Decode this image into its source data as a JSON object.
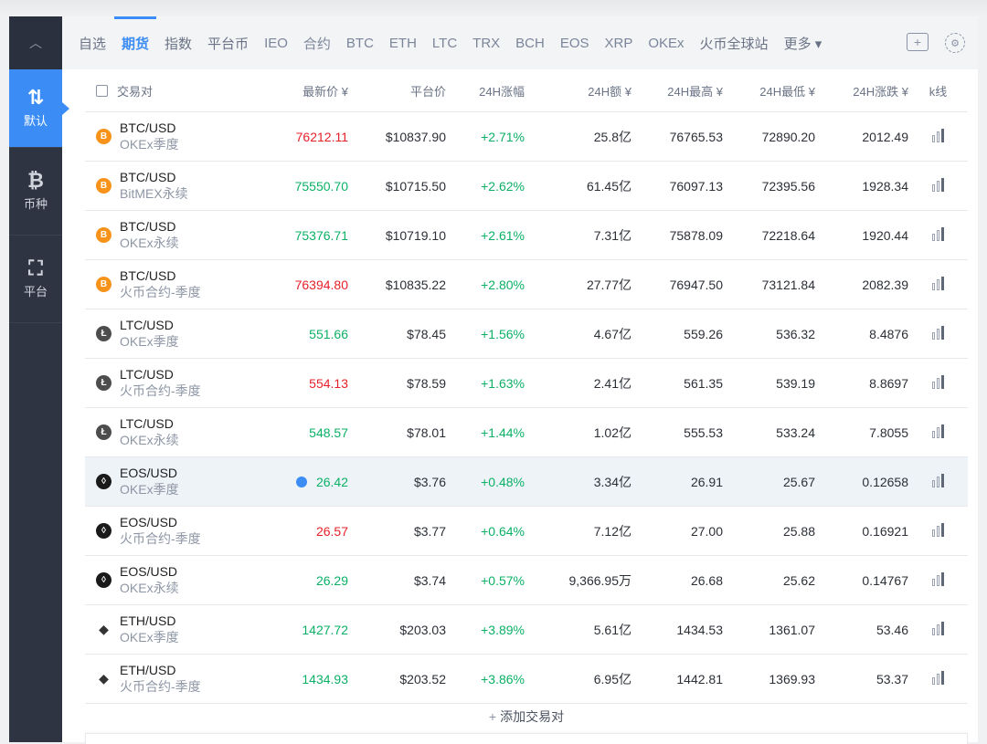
{
  "sidebar": {
    "collapse_icon": "chevron-up-icon",
    "items": [
      {
        "label": "默认",
        "icon": "sort-arrows-icon",
        "glyph": "⇅",
        "active": true
      },
      {
        "label": "币种",
        "icon": "bitcoin-icon",
        "glyph": "₿",
        "active": false
      },
      {
        "label": "平台",
        "icon": "chart-box-icon",
        "glyph": "⛶",
        "active": false
      }
    ]
  },
  "tabs": [
    {
      "label": "自选",
      "active": false
    },
    {
      "label": "期货",
      "active": true
    },
    {
      "label": "指数",
      "active": false
    },
    {
      "label": "平台币",
      "active": false
    },
    {
      "label": "IEO",
      "active": false
    },
    {
      "label": "合约",
      "active": false
    },
    {
      "label": "BTC",
      "active": false
    },
    {
      "label": "ETH",
      "active": false
    },
    {
      "label": "LTC",
      "active": false
    },
    {
      "label": "TRX",
      "active": false
    },
    {
      "label": "BCH",
      "active": false
    },
    {
      "label": "EOS",
      "active": false
    },
    {
      "label": "XRP",
      "active": false
    },
    {
      "label": "OKEx",
      "active": false
    },
    {
      "label": "火币全球站",
      "active": false
    },
    {
      "label": "更多 ▾",
      "active": false
    }
  ],
  "tools": {
    "add_folder_icon": "folder-plus-icon",
    "settings_icon": "gear-icon"
  },
  "columns": {
    "pair": "交易对",
    "last_price": "最新价 ¥",
    "platform_price": "平台价",
    "change_pct": "24H涨幅",
    "volume": "24H额 ¥",
    "high": "24H最高 ¥",
    "low": "24H最低 ¥",
    "change_abs": "24H涨跌 ¥",
    "kline": "k线"
  },
  "rows": [
    {
      "coin": "btc",
      "pair": "BTC/USD",
      "exchange": "OKEx季度",
      "price": "76212.11",
      "price_color": "red",
      "platform": "$10837.90",
      "pct": "+2.71%",
      "vol": "25.8亿",
      "high": "76765.53",
      "low": "72890.20",
      "chg": "2012.49"
    },
    {
      "coin": "btc",
      "pair": "BTC/USD",
      "exchange": "BitMEX永续",
      "price": "75550.70",
      "price_color": "green",
      "platform": "$10715.50",
      "pct": "+2.62%",
      "vol": "61.45亿",
      "high": "76097.13",
      "low": "72395.56",
      "chg": "1928.34"
    },
    {
      "coin": "btc",
      "pair": "BTC/USD",
      "exchange": "OKEx永续",
      "price": "75376.71",
      "price_color": "green",
      "platform": "$10719.10",
      "pct": "+2.61%",
      "vol": "7.31亿",
      "high": "75878.09",
      "low": "72218.64",
      "chg": "1920.44"
    },
    {
      "coin": "btc",
      "pair": "BTC/USD",
      "exchange": "火币合约-季度",
      "price": "76394.80",
      "price_color": "red",
      "platform": "$10835.22",
      "pct": "+2.80%",
      "vol": "27.77亿",
      "high": "76947.50",
      "low": "73121.84",
      "chg": "2082.39"
    },
    {
      "coin": "ltc",
      "pair": "LTC/USD",
      "exchange": "OKEx季度",
      "price": "551.66",
      "price_color": "green",
      "platform": "$78.45",
      "pct": "+1.56%",
      "vol": "4.67亿",
      "high": "559.26",
      "low": "536.32",
      "chg": "8.4876"
    },
    {
      "coin": "ltc",
      "pair": "LTC/USD",
      "exchange": "火币合约-季度",
      "price": "554.13",
      "price_color": "red",
      "platform": "$78.59",
      "pct": "+1.63%",
      "vol": "2.41亿",
      "high": "561.35",
      "low": "539.19",
      "chg": "8.8697"
    },
    {
      "coin": "ltc",
      "pair": "LTC/USD",
      "exchange": "OKEx永续",
      "price": "548.57",
      "price_color": "green",
      "platform": "$78.01",
      "pct": "+1.44%",
      "vol": "1.02亿",
      "high": "555.53",
      "low": "533.24",
      "chg": "7.8055"
    },
    {
      "coin": "eos",
      "pair": "EOS/USD",
      "exchange": "OKEx季度",
      "price": "26.42",
      "price_color": "green",
      "platform": "$3.76",
      "pct": "+0.48%",
      "vol": "3.34亿",
      "high": "26.91",
      "low": "25.67",
      "chg": "0.12658",
      "highlight": true
    },
    {
      "coin": "eos",
      "pair": "EOS/USD",
      "exchange": "火币合约-季度",
      "price": "26.57",
      "price_color": "red",
      "platform": "$3.77",
      "pct": "+0.64%",
      "vol": "7.12亿",
      "high": "27.00",
      "low": "25.88",
      "chg": "0.16921"
    },
    {
      "coin": "eos",
      "pair": "EOS/USD",
      "exchange": "OKEx永续",
      "price": "26.29",
      "price_color": "green",
      "platform": "$3.74",
      "pct": "+0.57%",
      "vol": "9,366.95万",
      "high": "26.68",
      "low": "25.62",
      "chg": "0.14767"
    },
    {
      "coin": "eth",
      "pair": "ETH/USD",
      "exchange": "OKEx季度",
      "price": "1427.72",
      "price_color": "green",
      "platform": "$203.03",
      "pct": "+3.89%",
      "vol": "5.61亿",
      "high": "1434.53",
      "low": "1361.07",
      "chg": "53.46"
    },
    {
      "coin": "eth",
      "pair": "ETH/USD",
      "exchange": "火币合约-季度",
      "price": "1434.93",
      "price_color": "green",
      "platform": "$203.52",
      "pct": "+3.86%",
      "vol": "6.95亿",
      "high": "1442.81",
      "low": "1369.93",
      "chg": "53.37"
    }
  ],
  "add_pair": {
    "plus": "+",
    "label": "添加交易对"
  },
  "colors": {
    "accent": "#3b8cf5",
    "up": "#0bb065",
    "down": "#e6212a",
    "sidebar": "#2e3442"
  }
}
